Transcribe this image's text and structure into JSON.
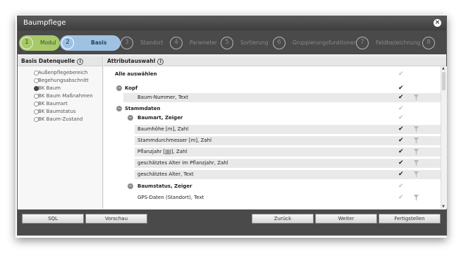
{
  "window": {
    "title": "Baumpflege",
    "close_icon": "close-icon"
  },
  "wizard": {
    "steps": [
      {
        "num": "1",
        "label": "Modul",
        "state": "done"
      },
      {
        "num": "2",
        "label": "Basis",
        "state": "active"
      },
      {
        "num": "3",
        "label": "Standort",
        "state": "inactive"
      },
      {
        "num": "4",
        "label": "Parameter",
        "state": "inactive"
      },
      {
        "num": "5",
        "label": "Sortierung",
        "state": "inactive"
      },
      {
        "num": "6",
        "label": "Gruppierungsfunktionen",
        "state": "inactive"
      },
      {
        "num": "7",
        "label": "Feldbezeichnung",
        "state": "inactive"
      },
      {
        "num": "8",
        "label": "",
        "state": "inactive"
      }
    ]
  },
  "left_panel": {
    "title": "Basis Datenquelle",
    "info_icon": "info-icon",
    "options": [
      {
        "label": "Außenpflegebereich",
        "selected": false
      },
      {
        "label": "Begehungsabschnitt",
        "selected": false
      },
      {
        "label": "BK Baum",
        "selected": true
      },
      {
        "label": "BK Baum Maßnahmen",
        "selected": false
      },
      {
        "label": "BK Baumart",
        "selected": false
      },
      {
        "label": "BK Baumstatus",
        "selected": false
      },
      {
        "label": "BK Baum-Zustand",
        "selected": false
      }
    ]
  },
  "right_panel": {
    "title": "Attributauswahl",
    "info_icon": "info-icon",
    "rows": [
      {
        "text": "Alle auswählen",
        "kind": "select-all",
        "checked": false,
        "filter": false
      },
      {
        "text": "Kopf",
        "kind": "group",
        "checked": true,
        "filter": false
      },
      {
        "text": "Baum-Nummer, Text",
        "kind": "attr1",
        "checked": true,
        "filter": true
      },
      {
        "text": "Stammdaten",
        "kind": "group",
        "checked": false,
        "filter": false
      },
      {
        "text": "Baumart, Zeiger",
        "kind": "subgroup",
        "checked": false,
        "filter": false
      },
      {
        "text": "Baumhöhe [m], Zahl",
        "kind": "attr2",
        "checked": true,
        "filter": true
      },
      {
        "text": "Stammdurchmesser [m], Zahl",
        "kind": "attr2",
        "checked": true,
        "filter": true
      },
      {
        "text": "Pflanzjahr [JJJJ], Zahl",
        "kind": "attr2",
        "checked": true,
        "filter": true
      },
      {
        "text": "geschätztes Alter im Pflanzjahr, Zahl",
        "kind": "attr2",
        "checked": true,
        "filter": true
      },
      {
        "text": "geschätztes Alter, Text",
        "kind": "attr2",
        "checked": true,
        "filter": true
      },
      {
        "text": "Baumstatus, Zeiger",
        "kind": "subgroup",
        "checked": false,
        "filter": false
      },
      {
        "text": "GPS-Daten (Standort), Text",
        "kind": "attr1plain",
        "checked": false,
        "filter": true
      }
    ]
  },
  "buttons": {
    "sql": "SQL",
    "preview": "Vorschau",
    "back": "Zurück",
    "next": "Weiter",
    "finish": "Fertigstellen"
  }
}
